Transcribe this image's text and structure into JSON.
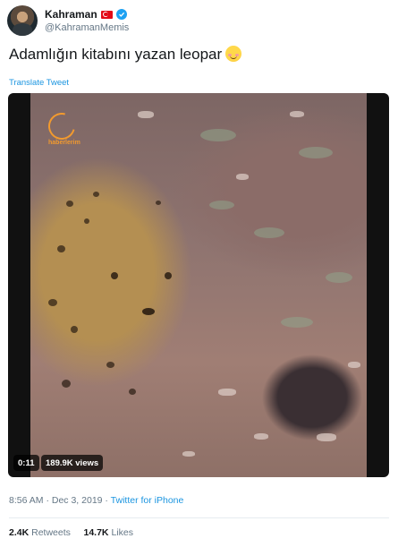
{
  "author": {
    "display_name": "Kahraman",
    "handle": "@KahramanMemis",
    "flag_icon": "turkey-flag-icon",
    "verified_icon": "verified-badge-icon"
  },
  "tweet": {
    "text": "Adamlığın kitabını yazan leopar",
    "emoji": "smiling-face-emoji",
    "translate_label": "Translate Tweet"
  },
  "video": {
    "duration": "0:11",
    "views": "189.9K views",
    "channel_watermark": "haberlerim"
  },
  "meta": {
    "time": "8:56 AM",
    "separator1": " · ",
    "date": "Dec 3, 2019",
    "separator2": " · ",
    "client": "Twitter for iPhone"
  },
  "stats": {
    "retweets_count": "2.4K",
    "retweets_label": "Retweets",
    "likes_count": "14.7K",
    "likes_label": "Likes"
  },
  "colors": {
    "link_blue": "#1b95e0",
    "verified_blue": "#1da1f2",
    "secondary_text": "#657786"
  }
}
